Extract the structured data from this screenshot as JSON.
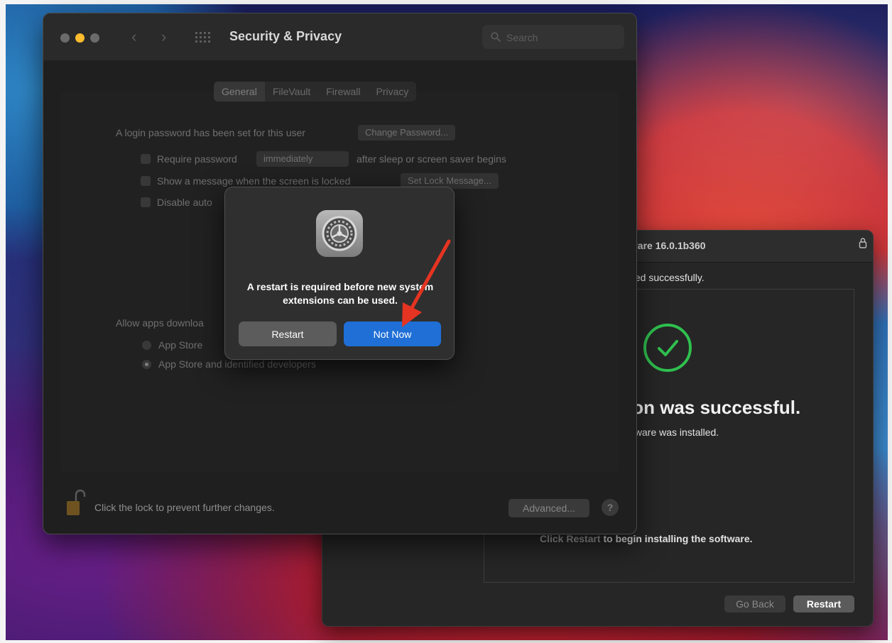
{
  "installer": {
    "title_fragment": "vare 16.0.1b360",
    "subtitle_fragment": "ted successfully.",
    "success_fragment": "ion was successful.",
    "installed_fragment": "tware was installed.",
    "hint_prefix": "Click Restart",
    "hint_suffix": " to begin installing the software.",
    "go_back_label": "Go Back",
    "restart_label": "Restart"
  },
  "prefs": {
    "window_title": "Security & Privacy",
    "search_placeholder": "Search",
    "tabs": [
      {
        "label": "General"
      },
      {
        "label": "FileVault"
      },
      {
        "label": "Firewall"
      },
      {
        "label": "Privacy"
      }
    ],
    "login_password_text": "A login password has been set for this user",
    "change_password_label": "Change Password...",
    "require_password_label": "Require password",
    "require_password_value": "immediately",
    "after_sleep_text": "after sleep or screen saver begins",
    "show_message_label": "Show a message when the screen is locked",
    "set_lock_message_label": "Set Lock Message...",
    "disable_auto_label": "Disable auto",
    "allow_apps_label": "Allow apps downloa",
    "radio_app_store": "App Store",
    "radio_app_store_identified": "App Store and identified developers",
    "lock_text": "Click the lock to prevent further changes.",
    "advanced_label": "Advanced...",
    "help_label": "?"
  },
  "alert": {
    "message": "A restart is required before new system extensions can be used.",
    "restart_label": "Restart",
    "not_now_label": "Not Now"
  },
  "colors": {
    "accent_blue": "#1f6fd6",
    "success_green": "#2fc14f",
    "annotation_red": "#e53421"
  }
}
